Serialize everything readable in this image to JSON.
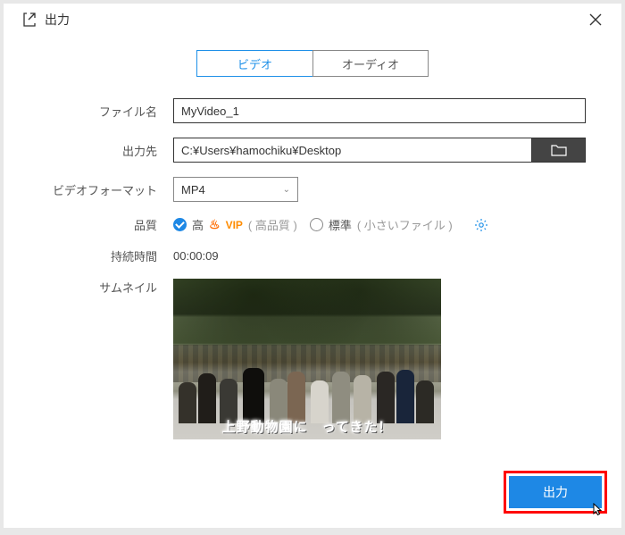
{
  "header": {
    "title": "出力"
  },
  "tabs": {
    "video": "ビデオ",
    "audio": "オーディオ"
  },
  "labels": {
    "filename": "ファイル名",
    "output_to": "出力先",
    "video_format": "ビデオフォーマット",
    "quality": "品質",
    "duration": "持続時間",
    "thumbnail": "サムネイル"
  },
  "fields": {
    "filename_value": "MyVideo_1",
    "output_path": "C:¥Users¥hamochiku¥Desktop",
    "format_value": "MP4",
    "duration_value": "00:00:09"
  },
  "quality": {
    "high_label": "高",
    "vip_label": "VIP",
    "high_note": "( 高品質 )",
    "standard_label": "標準",
    "standard_note": "( 小さいファイル )"
  },
  "thumbnail": {
    "caption": "上野動物園に　ってきた！"
  },
  "footer": {
    "export_label": "出力"
  }
}
